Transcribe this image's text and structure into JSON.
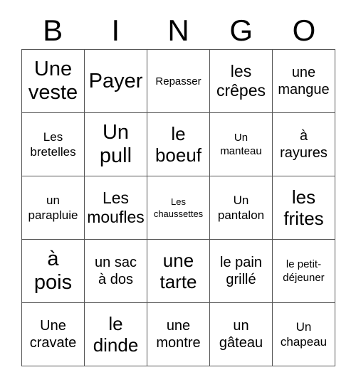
{
  "card": {
    "title_letters": [
      "B",
      "I",
      "N",
      "G",
      "O"
    ],
    "grid_size": "5x5",
    "colors": {
      "background": "#ffffff",
      "text": "#000000",
      "grid_line": "#555555"
    },
    "rows": [
      [
        {
          "text": "Une\nveste",
          "size": "xxl"
        },
        {
          "text": "Payer",
          "size": "xxl"
        },
        {
          "text": "Repasser",
          "size": "xs"
        },
        {
          "text": "les\ncrêpes",
          "size": "l"
        },
        {
          "text": "une\nmangue",
          "size": "m"
        }
      ],
      [
        {
          "text": "Les\nbretelles",
          "size": "s"
        },
        {
          "text": "Un\npull",
          "size": "xxl"
        },
        {
          "text": "le\nboeuf",
          "size": "xl"
        },
        {
          "text": "Un\nmanteau",
          "size": "xs"
        },
        {
          "text": "à\nrayures",
          "size": "m"
        }
      ],
      [
        {
          "text": "un\nparapluie",
          "size": "s"
        },
        {
          "text": "Les\nmoufles",
          "size": "l"
        },
        {
          "text": "Les\nchaussettes",
          "size": "xxs"
        },
        {
          "text": "Un\npantalon",
          "size": "s"
        },
        {
          "text": "les\nfrites",
          "size": "xl"
        }
      ],
      [
        {
          "text": "à\npois",
          "size": "xxl"
        },
        {
          "text": "un sac\nà dos",
          "size": "m"
        },
        {
          "text": "une\ntarte",
          "size": "xl"
        },
        {
          "text": "le pain\ngrillé",
          "size": "m"
        },
        {
          "text": "le petit-\ndéjeuner",
          "size": "xs"
        }
      ],
      [
        {
          "text": "Une\ncravate",
          "size": "m"
        },
        {
          "text": "le\ndinde",
          "size": "xl"
        },
        {
          "text": "une\nmontre",
          "size": "m"
        },
        {
          "text": "un\ngâteau",
          "size": "m"
        },
        {
          "text": "Un\nchapeau",
          "size": "s"
        }
      ]
    ]
  }
}
